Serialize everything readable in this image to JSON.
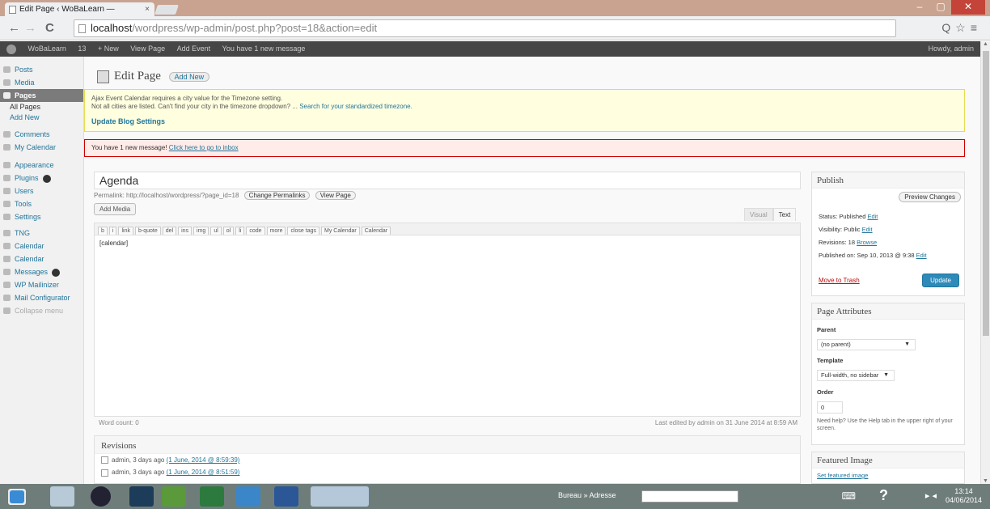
{
  "browser": {
    "tab_title": "Edit Page ‹ WoBaLearn — ",
    "tab_close": "×",
    "window_controls": [
      "–",
      "▢",
      "✕"
    ],
    "back": "←",
    "forward": "→",
    "reload": "C",
    "url_host": "localhost",
    "url_path": "/wordpress/wp-admin/post.php?post=18&action=edit",
    "right_icons": "Q☆≡"
  },
  "adminbar": {
    "site_name": "WoBaLearn",
    "updates": "13",
    "new": "+ New",
    "view_page": "View Page",
    "add_event": "Add Event",
    "messages": "You have 1 new message",
    "howdy": "Howdy, admin"
  },
  "sidebar": {
    "items": [
      {
        "label": "Posts",
        "active": false
      },
      {
        "label": "Media",
        "active": false
      },
      {
        "label": "Pages",
        "active": true
      },
      {
        "label": "Comments",
        "active": false
      },
      {
        "label": "My Calendar",
        "active": false
      },
      {
        "label": "Appearance",
        "active": false
      },
      {
        "label": "Plugins",
        "active": false
      },
      {
        "label": "Users",
        "active": false
      },
      {
        "label": "Tools",
        "active": false
      },
      {
        "label": "Settings",
        "active": false
      },
      {
        "label": "TNG",
        "active": false
      },
      {
        "label": "Calendar",
        "active": false
      },
      {
        "label": "Calendar",
        "active": false
      },
      {
        "label": "Messages",
        "active": false
      },
      {
        "label": "WP Mailinizer",
        "active": false
      },
      {
        "label": "Mail Configurator",
        "active": false
      },
      {
        "label": "Collapse menu",
        "active": false
      }
    ],
    "submenu": [
      "All Pages",
      "Add New"
    ]
  },
  "main": {
    "title": "Edit Page",
    "add_new": "Add New",
    "notice_yellow": {
      "line1": "Ajax Event Calendar requires a city value for the Timezone setting.",
      "line2": "Not all cities are listed. Can't find your city in the timezone dropdown? ... ",
      "line2_link": "Search for your standardized timezone.",
      "update": "Update Blog Settings"
    },
    "notice_red": {
      "text": "You have 1 new message! ",
      "link": "Click here to go to inbox"
    },
    "post_title": "Agenda",
    "permalink_text": "Permalink: http://localhost/wordpress/?page_id=18",
    "change_permalinks": "Change Permalinks",
    "view_page": "View Page",
    "add_media": "Add Media",
    "tab_visual": "Visual",
    "tab_text": "Text",
    "toolbar": [
      "b",
      "i",
      "link",
      "b-quote",
      "del",
      "ins",
      "img",
      "ul",
      "ol",
      "li",
      "code",
      "more",
      "close tags",
      "My Calendar",
      "Calendar"
    ],
    "content": "[calendar]",
    "word_count": "Word count: 0",
    "last_edited": "Last edited by admin on 31 June 2014 at 8:59 AM",
    "revisions": {
      "heading": "Revisions",
      "rows": [
        {
          "text": "admin, 3 days ago ",
          "link": "(1 June, 2014 @ 8:59:39)"
        },
        {
          "text": "admin, 3 days ago ",
          "link": "(1 June, 2014 @ 8:51:59)"
        }
      ]
    }
  },
  "publish": {
    "heading": "Publish",
    "preview": "Preview Changes",
    "status": "Status: Published ",
    "visibility": "Visibility: Public ",
    "revisions": "Revisions: 18 ",
    "published_on": "Published on: Sep 10, 2013 @ 9:38 ",
    "edit": "Edit",
    "browse": "Browse",
    "trash": "Move to Trash",
    "update": "Update"
  },
  "attributes": {
    "heading": "Page Attributes",
    "parent_label": "Parent",
    "parent_value": "(no parent)",
    "template_label": "Template",
    "template_value": "Full-width, no sidebar",
    "order_label": "Order",
    "order_value": "0",
    "help": "Need help? Use the Help tab in the upper right of your screen."
  },
  "featured": {
    "heading": "Featured Image",
    "link": "Set featured image"
  },
  "taskbar": {
    "labels": "Bureau  »  Adresse",
    "time": "13:14",
    "date": "04/06/2014"
  }
}
